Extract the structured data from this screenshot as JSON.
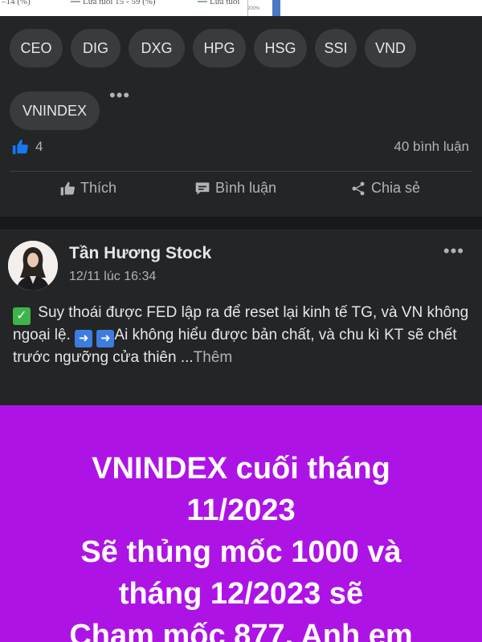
{
  "chart_strip": {
    "legend_1": "–14 (%)",
    "legend_2": "Lứa tuổi 15 - 59 (%)",
    "legend_3": "Lứa tuổi",
    "axis_label": "200%"
  },
  "tags": [
    "CEO",
    "DIG",
    "DXG",
    "HPG",
    "HSG",
    "SSI",
    "VND",
    "VNINDEX"
  ],
  "post1": {
    "reaction_count": "4",
    "comments_label": "40 bình luận",
    "actions": {
      "like": "Thích",
      "comment": "Bình luận",
      "share": "Chia sẻ"
    }
  },
  "post2": {
    "author": "Tần Hương Stock",
    "timestamp": "12/11 lúc 16:34",
    "text_part1": " Suy thoái được FED lập ra để reset lại kinh tế TG, và VN không ngoại lệ. ",
    "text_part2": "Ai không hiểu được bản chất, và chu kì KT sẽ chết trước ngưỡng cửa thiên ...",
    "see_more": "Thêm",
    "banner_lines": [
      "VNINDEX cuối tháng",
      "11/2023",
      "Sẽ thủng mốc 1000 và",
      "tháng 12/2023 sẽ",
      "Chạm mốc 877. Anh em"
    ]
  },
  "colors": {
    "banner_bg": "#ae13e5",
    "card_bg": "#242526",
    "like_blue": "#1877f2"
  }
}
